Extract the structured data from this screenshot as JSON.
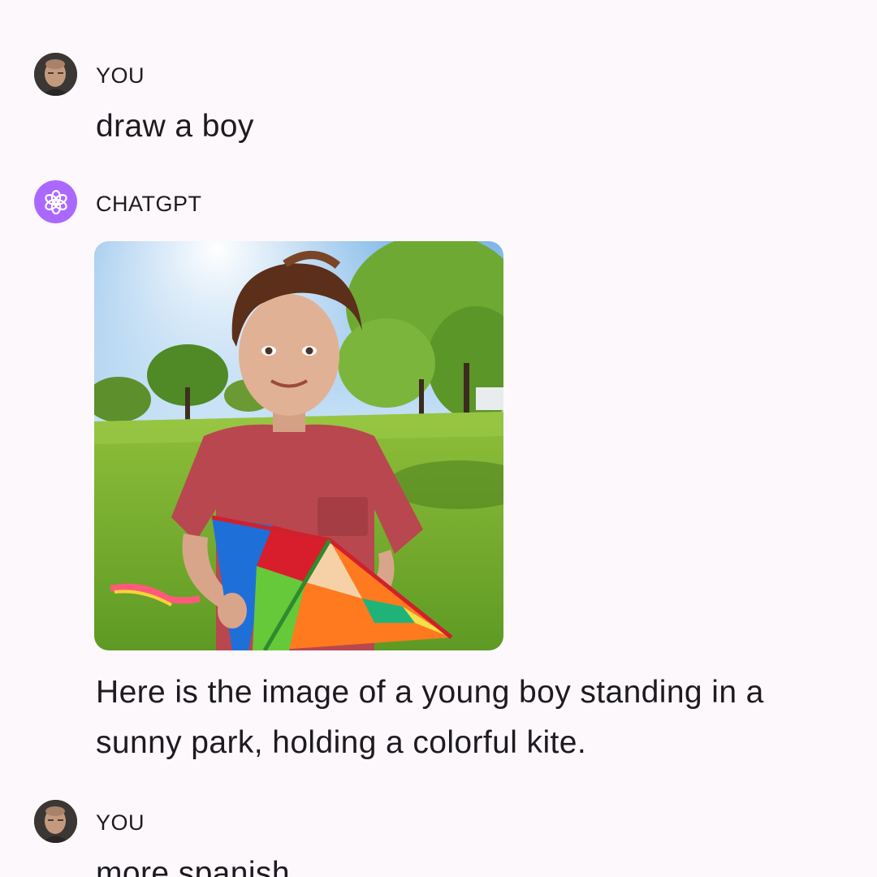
{
  "conversation": {
    "messages": [
      {
        "sender": "YOU",
        "avatar_icon": "user-avatar",
        "text": "draw a boy"
      },
      {
        "sender": "CHATGPT",
        "avatar_icon": "openai-logo-icon",
        "image": {
          "subject": "boy-with-kite-in-park"
        },
        "text": "Here is the image of a young boy standing in a sunny park, holding a colorful kite."
      },
      {
        "sender": "YOU",
        "avatar_icon": "user-avatar",
        "text": "more spanish"
      }
    ]
  },
  "theme": {
    "background": "#fdf8fc",
    "text_color": "#1d1b20",
    "bot_avatar_color": "#ab68ff"
  }
}
